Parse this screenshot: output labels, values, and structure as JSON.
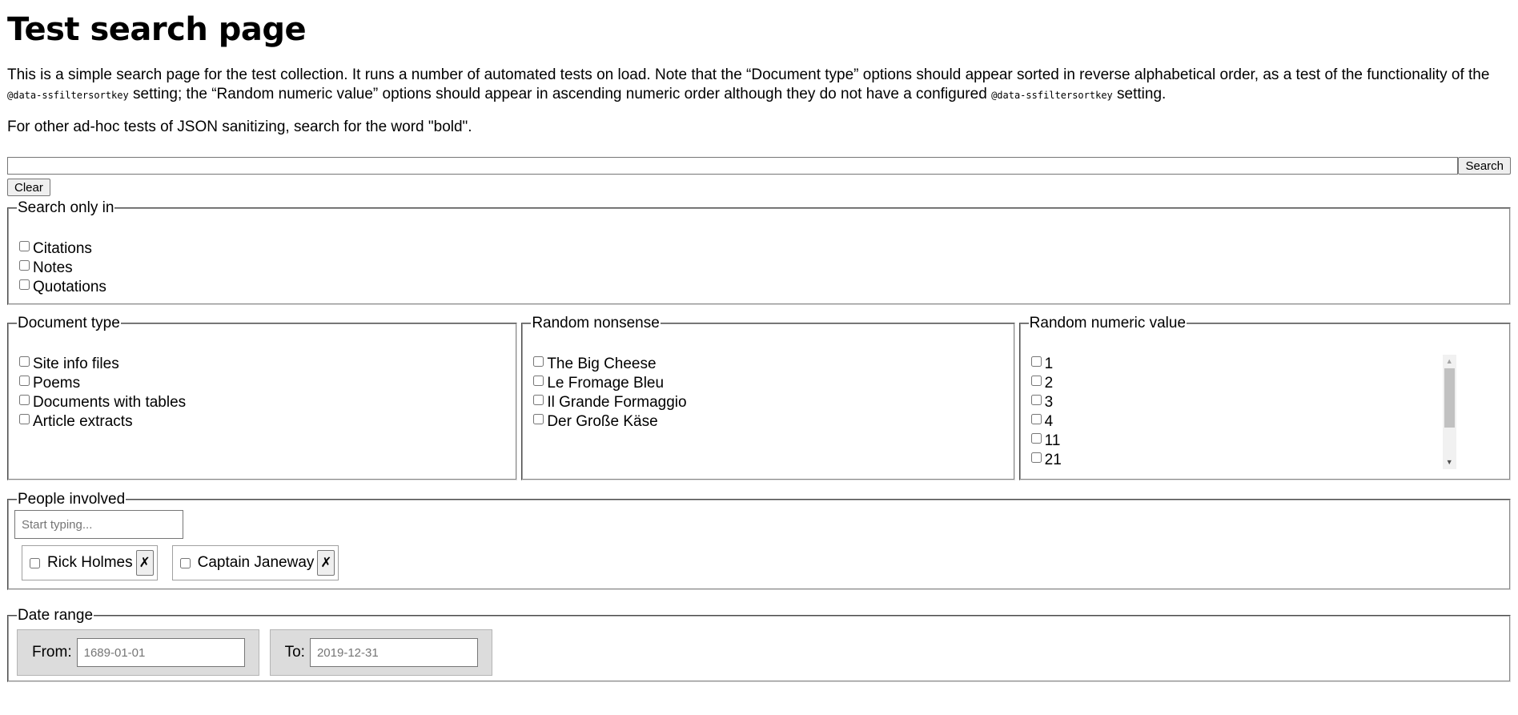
{
  "title": "Test search page",
  "intro": {
    "p1_a": "This is a simple search page for the test collection. It runs a number of automated tests on load. Note that the “Document type” options should appear sorted in reverse alphabetical order, as a test of the functionality of the ",
    "p1_code1": "@data-ssfiltersortkey",
    "p1_b": " setting; the “Random numeric value” options should appear in ascending numeric order although they do not have a configured ",
    "p1_code2": "@data-ssfiltersortkey",
    "p1_c": " setting.",
    "p2": "For other ad-hoc tests of JSON sanitizing, search for the word \"bold\"."
  },
  "search": {
    "value": "",
    "button_label": "Search",
    "clear_label": "Clear"
  },
  "search_only_in": {
    "legend": "Search only in",
    "options": [
      "Citations",
      "Notes",
      "Quotations"
    ]
  },
  "document_type": {
    "legend": "Document type",
    "options": [
      "Site info files",
      "Poems",
      "Documents with tables",
      "Article extracts"
    ]
  },
  "random_nonsense": {
    "legend": "Random nonsense",
    "options": [
      "The Big Cheese",
      "Le Fromage Bleu",
      "Il Grande Formaggio",
      "Der Große Käse"
    ]
  },
  "random_numeric": {
    "legend": "Random numeric value",
    "options": [
      "1",
      "2",
      "3",
      "4",
      "11",
      "21"
    ]
  },
  "people": {
    "legend": "People involved",
    "placeholder": "Start typing...",
    "chips": [
      {
        "label": "Rick Holmes",
        "remove": "✗"
      },
      {
        "label": "Captain Janeway",
        "remove": "✗"
      }
    ]
  },
  "date_range": {
    "legend": "Date range",
    "from_label": "From:",
    "from_placeholder": "1689-01-01",
    "to_label": "To:",
    "to_placeholder": "2019-12-31"
  }
}
